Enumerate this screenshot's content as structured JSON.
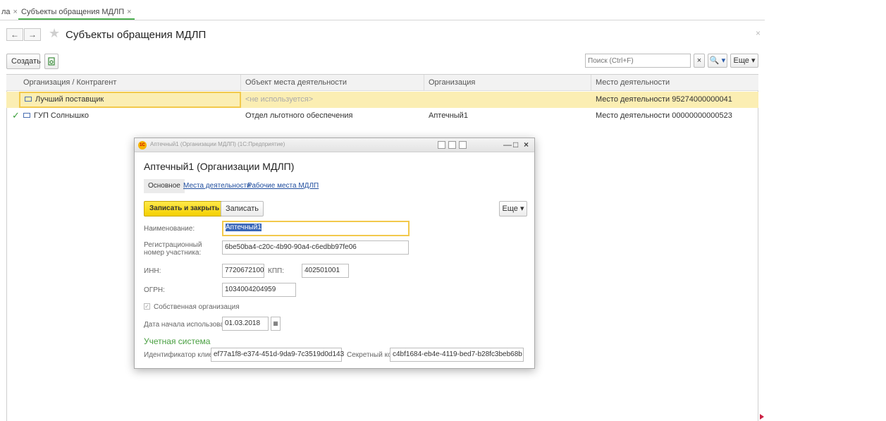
{
  "tabs": [
    {
      "label": "ла",
      "close": "×"
    },
    {
      "label": "Субъекты обращения МДЛП",
      "close": "×"
    }
  ],
  "header": {
    "back": "←",
    "forward": "→",
    "star": "★",
    "title": "Субъекты обращения МДЛП",
    "close": "×"
  },
  "toolbar": {
    "create_label": "Создать",
    "search_placeholder": "Поиск (Ctrl+F)",
    "search_clear": "×",
    "search_btn": "🔍 ▾",
    "more_label": "Еще ▾"
  },
  "list": {
    "columns": [
      "Организация / Контрагент",
      "Объект места деятельности",
      "Организация",
      "Место деятельности"
    ],
    "rows": [
      {
        "name": "Лучший поставщик",
        "object": "<не используется>",
        "org": "",
        "place": "Место деятельности 95274000000041",
        "checked": ""
      },
      {
        "name": "ГУП Солнышко",
        "object": "Отдел льготного обеспечения",
        "org": "Аптечный1",
        "place": "Место деятельности 00000000000523",
        "checked": "✓"
      }
    ]
  },
  "dialog": {
    "window_title": "Аптечный1 (Организации МДЛП) (1С:Предприятие)",
    "logo": "1С",
    "ctrl_min": "—",
    "ctrl_max": "□",
    "ctrl_close": "×",
    "form_title": "Аптечный1 (Организации МДЛП)",
    "tabs": {
      "main": "Основное",
      "places": "Места деятельности",
      "workplaces": "Рабочие места МДЛП"
    },
    "save_close_label": "Записать и закрыть",
    "save_label": "Записать",
    "more_label": "Еще ▾",
    "fields": {
      "name_label": "Наименование:",
      "name_value": "Аптечный1",
      "reg_label_1": "Регистрационный",
      "reg_label_2": "номер участника:",
      "reg_value": "6be50ba4-c20c-4b90-90a4-c6edbb97fe06",
      "inn_label": "ИНН:",
      "inn_value": "7720672100",
      "kpp_label": "КПП:",
      "kpp_value": "402501001",
      "ogrn_label": "ОГРН:",
      "ogrn_value": "1034004204959",
      "own_org_label": "Собственная организация",
      "own_org_mark": "✓",
      "start_date_label": "Дата начала использования:",
      "start_date_value": "01.03.2018",
      "cal_icon": "▦"
    },
    "section_title": "Учетная система",
    "client_id_label": "Идентификатор клиента:",
    "client_id_value": "ef77a1f8-e374-451d-9da9-7c3519d0d143",
    "secret_label": "Секретный код:",
    "secret_value": "c4bf1684-eb4e-4119-bed7-b28fc3beb68b"
  }
}
